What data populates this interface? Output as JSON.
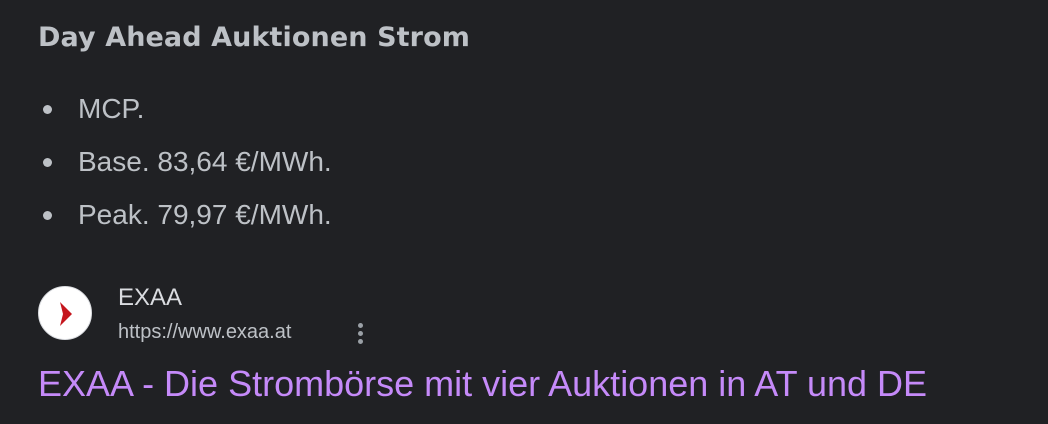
{
  "snippet": {
    "heading": "Day Ahead Auktionen Strom",
    "bullets": [
      "MCP.",
      "Base. 83,64 €/MWh.",
      "Peak. 79,97 €/MWh."
    ]
  },
  "source": {
    "favicon_icon": "exaa-logo-icon",
    "site_name": "EXAA",
    "url": "https://www.exaa.at",
    "more_icon": "more-vert-icon"
  },
  "result": {
    "title": "EXAA - Die Strombörse mit vier Auktionen in AT und DE",
    "title_color": "#c58af9"
  },
  "colors": {
    "background": "#202124",
    "text": "#bdc1c6",
    "logo_red": "#c5161d"
  }
}
